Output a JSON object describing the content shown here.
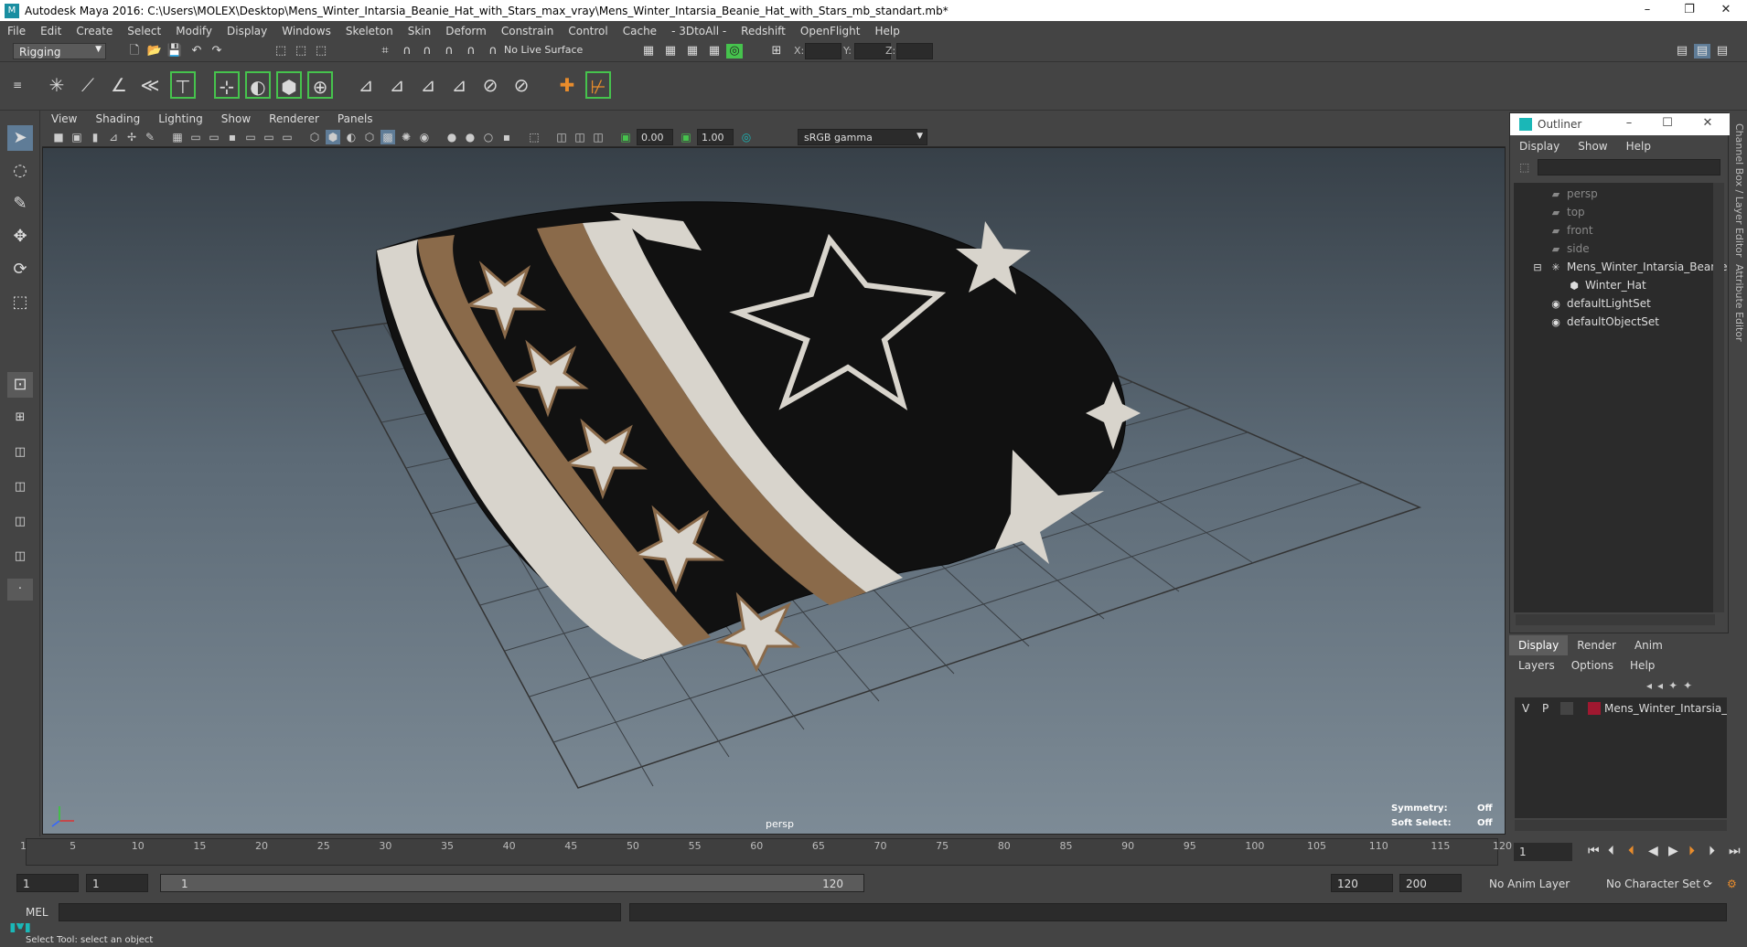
{
  "window": {
    "title": "Autodesk Maya 2016: C:\\Users\\MOLEX\\Desktop\\Mens_Winter_Intarsia_Beanie_Hat_with_Stars_max_vray\\Mens_Winter_Intarsia_Beanie_Hat_with_Stars_mb_standart.mb*",
    "minimize": "–",
    "restore": "❐",
    "close": "✕"
  },
  "menubar": [
    "File",
    "Edit",
    "Create",
    "Select",
    "Modify",
    "Display",
    "Windows",
    "Skeleton",
    "Skin",
    "Deform",
    "Constrain",
    "Control",
    "Cache",
    "- 3DtoAll -",
    "Redshift",
    "OpenFlight",
    "Help"
  ],
  "statusline": {
    "menu_set": "Rigging",
    "live_surface": "No Live Surface",
    "x_label": "X:",
    "y_label": "Y:",
    "z_label": "Z:"
  },
  "panel": {
    "menus": [
      "View",
      "Shading",
      "Lighting",
      "Show",
      "Renderer",
      "Panels"
    ],
    "exposure": "0.00",
    "gamma_value": "1.00",
    "color_space": "sRGB gamma"
  },
  "viewport": {
    "camera": "persp",
    "symmetry_label": "Symmetry:",
    "symmetry_value": "Off",
    "soft_select_label": "Soft Select:",
    "soft_select_value": "Off"
  },
  "outliner": {
    "title": "Outliner",
    "menus": [
      "Display",
      "Show",
      "Help"
    ],
    "items": [
      {
        "label": "persp",
        "icon": "camera-icon",
        "dim": true
      },
      {
        "label": "top",
        "icon": "camera-icon",
        "dim": true
      },
      {
        "label": "front",
        "icon": "camera-icon",
        "dim": true
      },
      {
        "label": "side",
        "icon": "camera-icon",
        "dim": true
      },
      {
        "label": "Mens_Winter_Intarsia_Beanie",
        "icon": "group-icon",
        "dim": false
      },
      {
        "label": "Winter_Hat",
        "icon": "mesh-icon",
        "dim": false
      },
      {
        "label": "defaultLightSet",
        "icon": "set-icon",
        "dim": false
      },
      {
        "label": "defaultObjectSet",
        "icon": "set-icon",
        "dim": false
      }
    ]
  },
  "side_tabs": [
    "Channel Box / Layer Editor",
    "Attribute Editor"
  ],
  "layer_editor": {
    "tabs": [
      "Display",
      "Render",
      "Anim"
    ],
    "menus": [
      "Layers",
      "Options",
      "Help"
    ],
    "layer": {
      "v": "V",
      "p": "P",
      "name": "Mens_Winter_Intarsia_Beanie_Hat_with_Stars",
      "color": "#a01830"
    }
  },
  "timeline": {
    "ticks": [
      "1",
      "5",
      "10",
      "15",
      "20",
      "25",
      "30",
      "35",
      "40",
      "45",
      "50",
      "55",
      "60",
      "65",
      "70",
      "75",
      "80",
      "85",
      "90",
      "95",
      "100",
      "105",
      "110",
      "115",
      "120"
    ],
    "current_frame": "1"
  },
  "range": {
    "start": "1",
    "playback_start": "1",
    "bar_start": "1",
    "bar_end": "120",
    "playback_end": "120",
    "end": "200",
    "anim_layer": "No Anim Layer",
    "character_set": "No Character Set"
  },
  "command": {
    "label": "MEL"
  },
  "help_line": "Select Tool: select an object",
  "colors": {
    "accent_green": "#46c34d",
    "maya_teal": "#1ab7b7",
    "selected_tool": "#5f7c97",
    "layer_color": "#a01830"
  }
}
